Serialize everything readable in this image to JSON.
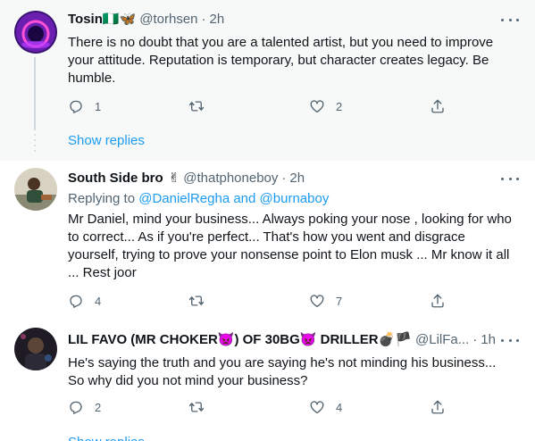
{
  "tweets": [
    {
      "name": "Tosin",
      "name_emoji": "🇳🇬🦋",
      "handle": "@torhsen",
      "time": "2h",
      "text": "There is no doubt that you are a talented artist, but you need to improve your attitude. Reputation is temporary, but character creates legacy. Be humble.",
      "replies": "1",
      "retweets": "",
      "likes": "2",
      "show_replies": "Show replies"
    },
    {
      "name": "South Side bro",
      "name_emoji": "✌",
      "handle": "@thatphoneboy",
      "time": "2h",
      "replying_prefix": "Replying to",
      "replying_user1": "@DanielRegha",
      "replying_and": "and",
      "replying_user2": "@burnaboy",
      "text": "Mr Daniel, mind your business... Always poking your nose , looking for who to correct... As if you're perfect... That's how you went and disgrace yourself, trying to prove your nonsense point to Elon musk ... Mr know it all ... Rest joor",
      "replies": "4",
      "retweets": "",
      "likes": "7"
    },
    {
      "name": "LIL FAVO (MR CHOKER👿) OF 30BG👿 DRILLER💣🏴",
      "handle": "@LilFa...",
      "time": "1h",
      "text": "He's saying the truth and you are saying he's not minding his business... So why did you not mind your business?",
      "replies": "2",
      "retweets": "",
      "likes": "4",
      "show_replies": "Show replies"
    }
  ],
  "colors": {
    "accent": "#1d9bf0",
    "muted": "#536471",
    "text": "#0f1419",
    "highlight_bg": "#f7f9f9"
  },
  "icons": [
    "reply-icon",
    "retweet-icon",
    "like-icon",
    "share-icon",
    "more-icon"
  ]
}
